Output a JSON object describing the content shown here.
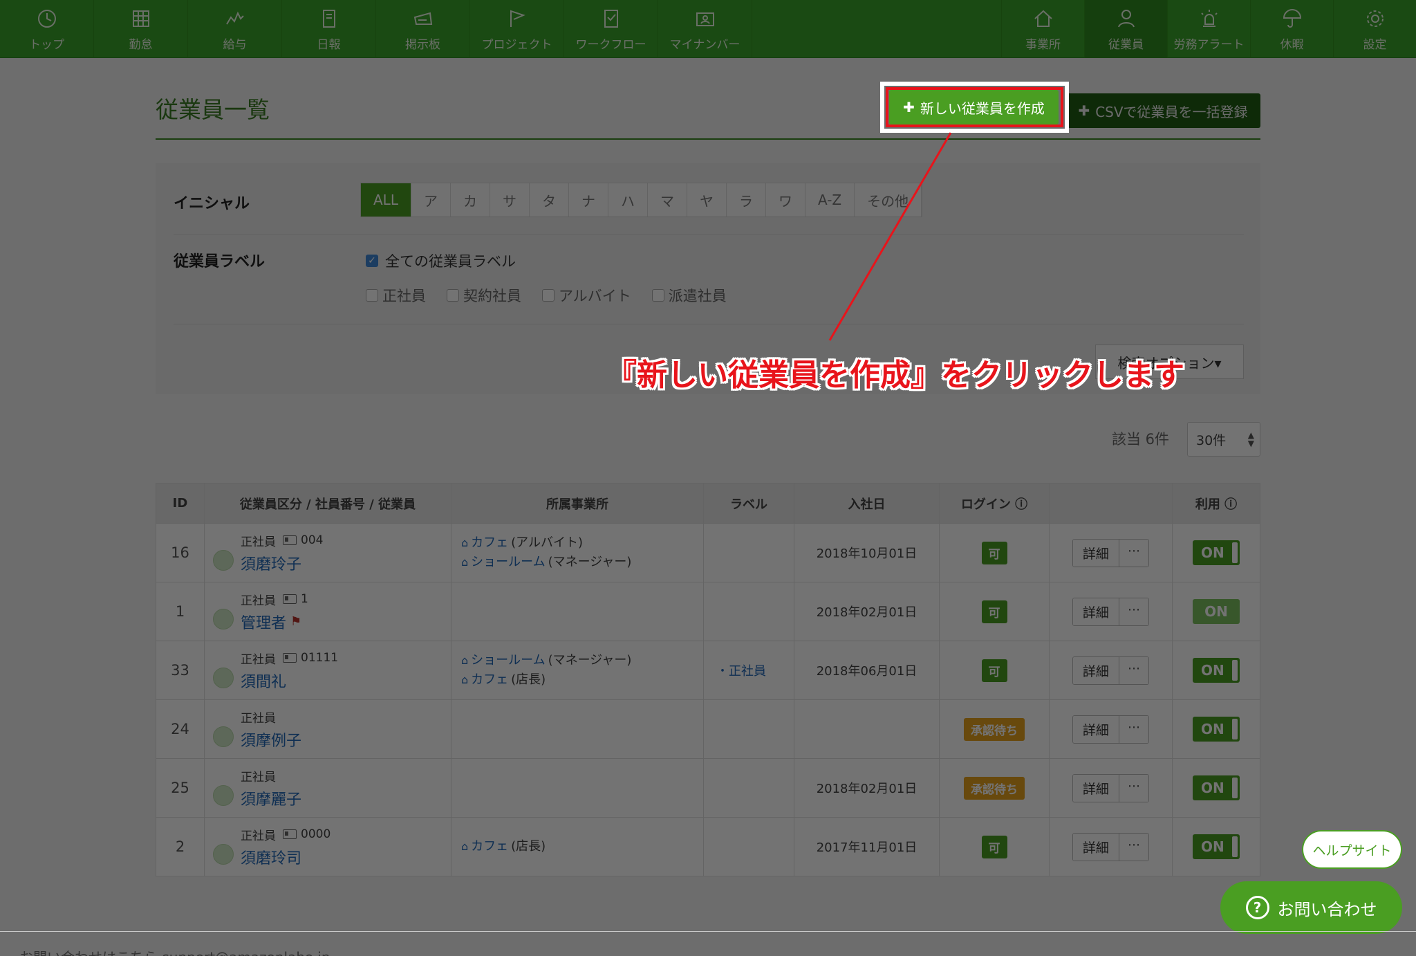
{
  "nav": {
    "left": [
      {
        "label": "トップ",
        "icon": "clock-icon"
      },
      {
        "label": "勤怠",
        "icon": "calendar-grid-icon"
      },
      {
        "label": "給与",
        "icon": "chart-zigzag-icon"
      },
      {
        "label": "日報",
        "icon": "notebook-icon"
      },
      {
        "label": "掲示板",
        "icon": "board-icon"
      },
      {
        "label": "プロジェクト",
        "icon": "flag-icon"
      },
      {
        "label": "ワークフロー",
        "icon": "checklist-icon"
      },
      {
        "label": "マイナンバー",
        "icon": "id-card-icon"
      }
    ],
    "right": [
      {
        "label": "事業所",
        "icon": "home-icon"
      },
      {
        "label": "従業員",
        "icon": "person-icon"
      },
      {
        "label": "労務アラート",
        "icon": "alert-light-icon"
      },
      {
        "label": "休暇",
        "icon": "umbrella-icon"
      },
      {
        "label": "設定",
        "icon": "gear-icon"
      }
    ]
  },
  "page": {
    "title": "従業員一覧",
    "new_button": "新しい従業員を作成",
    "csv_button": "CSVで従業員を一括登録"
  },
  "filters": {
    "initial_label": "イニシャル",
    "initials": [
      "ALL",
      "ア",
      "カ",
      "サ",
      "タ",
      "ナ",
      "ハ",
      "マ",
      "ヤ",
      "ラ",
      "ワ",
      "A-Z",
      "その他"
    ],
    "label_label": "従業員ラベル",
    "all_labels": "全ての従業員ラベル",
    "labels": [
      "正社員",
      "契約社員",
      "アルバイト",
      "派遣社員"
    ],
    "option_button": "検索オプション▾"
  },
  "result": {
    "count": "該当 6件",
    "per_page": "30件"
  },
  "table": {
    "headers": [
      "ID",
      "従業員区分 / 社員番号 / 従業員",
      "所属事業所",
      "ラベル",
      "入社日",
      "ログイン",
      "",
      "利用"
    ],
    "rows": [
      {
        "id": "16",
        "type": "正社員",
        "number": "004",
        "name": "須磨玲子",
        "offices": [
          {
            "name": "カフェ",
            "role": "(アルバイト)"
          },
          {
            "name": "ショールーム",
            "role": "(マネージャー)"
          }
        ],
        "label": "",
        "date": "2018年10月01日",
        "login": "可",
        "login_state": "ok",
        "detail": "詳細",
        "more": "···",
        "use": "ON"
      },
      {
        "id": "1",
        "type": "正社員",
        "number": "1",
        "name": "管理者",
        "flag": "⚑",
        "offices": [],
        "label": "",
        "date": "2018年02月01日",
        "login": "可",
        "login_state": "ok",
        "detail": "詳細",
        "more": "···",
        "use": "ON"
      },
      {
        "id": "33",
        "type": "正社員",
        "number": "01111",
        "name": "須間礼",
        "offices": [
          {
            "name": "ショールーム",
            "role": "(マネージャー)"
          },
          {
            "name": "カフェ",
            "role": "(店長)"
          }
        ],
        "label": "・正社員",
        "date": "2018年06月01日",
        "login": "可",
        "login_state": "ok",
        "detail": "詳細",
        "more": "···",
        "use": "ON"
      },
      {
        "id": "24",
        "type": "正社員",
        "number": "",
        "name": "須摩例子",
        "offices": [],
        "label": "",
        "date": "",
        "login": "承認待ち",
        "login_state": "wait",
        "detail": "詳細",
        "more": "···",
        "use": "ON"
      },
      {
        "id": "25",
        "type": "正社員",
        "number": "",
        "name": "須摩麗子",
        "offices": [],
        "label": "",
        "date": "2018年02月01日",
        "login": "承認待ち",
        "login_state": "wait",
        "detail": "詳細",
        "more": "···",
        "use": "ON"
      },
      {
        "id": "2",
        "type": "正社員",
        "number": "0000",
        "name": "須磨玲司",
        "offices": [
          {
            "name": "カフェ",
            "role": "(店長)"
          }
        ],
        "label": "",
        "date": "2017年11月01日",
        "login": "可",
        "login_state": "ok",
        "detail": "詳細",
        "more": "···",
        "use": "ON"
      }
    ]
  },
  "annotation": "『新しい従業員を作成』をクリックします",
  "help": {
    "site": "ヘルプサイト",
    "contact": "お問い合わせ",
    "contact_icon": "?"
  },
  "footer": "お問い合わせはこちら support@amazonlabo.jp",
  "colors": {
    "brand": "#3aa52a",
    "accent_red": "#e8141b",
    "link": "#2369b8",
    "wait": "#e7a21e"
  }
}
